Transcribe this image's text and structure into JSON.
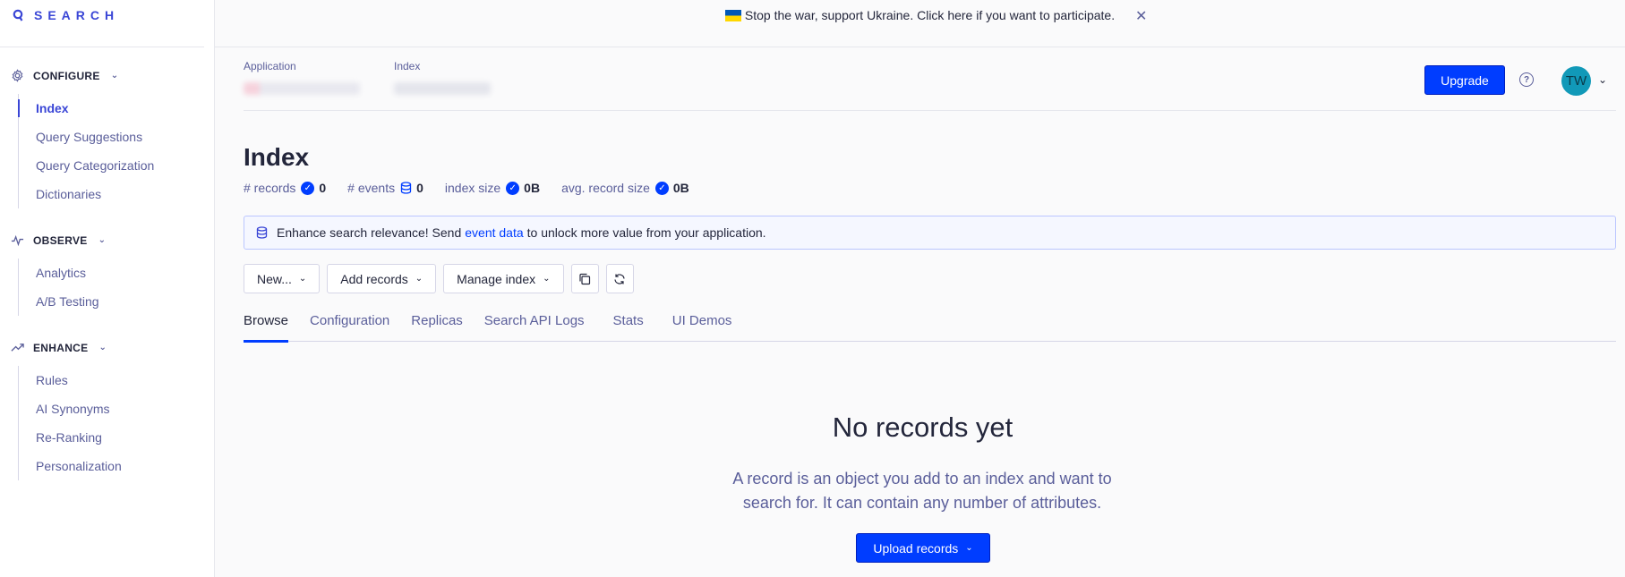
{
  "brand": {
    "logo_text": "SEARCH"
  },
  "banner": {
    "text": "Stop the war, support Ukraine. Click here if you want to participate."
  },
  "sidebar": {
    "sections": [
      {
        "title": "CONFIGURE",
        "icon": "gear-icon",
        "items": [
          "Index",
          "Query Suggestions",
          "Query Categorization",
          "Dictionaries"
        ]
      },
      {
        "title": "OBSERVE",
        "icon": "pulse-icon",
        "items": [
          "Analytics",
          "A/B Testing"
        ]
      },
      {
        "title": "ENHANCE",
        "icon": "trend-up-icon",
        "items": [
          "Rules",
          "AI Synonyms",
          "Re-Ranking",
          "Personalization"
        ]
      }
    ],
    "active_item": "Index"
  },
  "header": {
    "application_label": "Application",
    "index_label": "Index",
    "upgrade_label": "Upgrade",
    "avatar_initials": "TW"
  },
  "page": {
    "title": "Index",
    "stats": [
      {
        "label": "# records",
        "value": "0"
      },
      {
        "label": "# events",
        "value": "0"
      },
      {
        "label": "index size",
        "value": "0B"
      },
      {
        "label": "avg. record size",
        "value": "0B"
      }
    ]
  },
  "notice": {
    "prefix": "Enhance search relevance! Send",
    "link": "event data",
    "suffix": "to unlock more value from your application."
  },
  "toolbar": {
    "new_label": "New...",
    "add_records_label": "Add records",
    "manage_index_label": "Manage index"
  },
  "tabs": [
    "Browse",
    "Configuration",
    "Replicas",
    "Search API Logs",
    "Stats",
    "UI Demos"
  ],
  "active_tab": "Browse",
  "empty_state": {
    "title": "No records yet",
    "description": "A record is an object you add to an index and want to search for. It can contain any number of attributes.",
    "button_label": "Upload records"
  },
  "colors": {
    "primary": "#003dff",
    "accent": "#3a46d6",
    "text": "#23263b",
    "muted": "#5a5e9a"
  }
}
